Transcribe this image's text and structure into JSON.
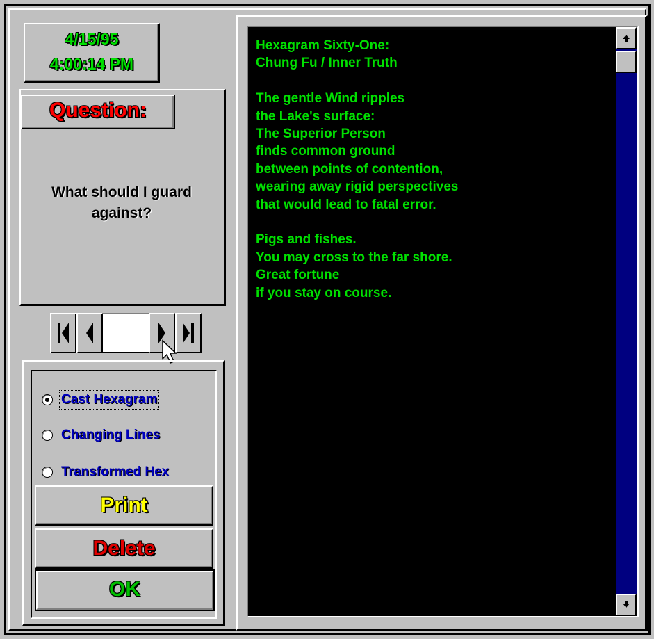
{
  "datetime": {
    "date": "4/15/95",
    "time": "4:00:14 PM"
  },
  "question": {
    "header": "Question:",
    "text": "What should I guard against?"
  },
  "navigator": {
    "first_icon": "first-record-icon",
    "prev_icon": "previous-record-icon",
    "next_icon": "next-record-icon",
    "last_icon": "last-record-icon",
    "current_value": ""
  },
  "options": [
    {
      "label": "Cast Hexagram",
      "selected": true
    },
    {
      "label": "Changing Lines",
      "selected": false
    },
    {
      "label": "Transformed Hex",
      "selected": false
    }
  ],
  "buttons": {
    "print": "Print",
    "delete": "Delete",
    "ok": "OK"
  },
  "reading": {
    "lines": [
      "Hexagram Sixty-One:",
      "Chung Fu / Inner Truth",
      "",
      "The gentle Wind ripples",
      "the Lake's surface:",
      "The Superior Person",
      "finds common ground",
      "between points of contention,",
      "wearing away rigid perspectives",
      "that would lead to fatal error.",
      "",
      "Pigs and fishes.",
      "You may cross to the far shore.",
      "Great fortune",
      "if you stay on course."
    ]
  },
  "colors": {
    "face": "#c0c0c0",
    "reading_bg": "#000000",
    "reading_text": "#00e000",
    "date_text": "#00e000",
    "question_header": "#ff0000",
    "option_text": "#0000c0",
    "print_text": "#ffff00",
    "delete_text": "#e00000",
    "ok_text": "#00c000",
    "scroll_track": "#000080"
  },
  "scrollbar": {
    "up_icon": "scroll-up-arrow-icon",
    "down_icon": "scroll-down-arrow-icon"
  }
}
